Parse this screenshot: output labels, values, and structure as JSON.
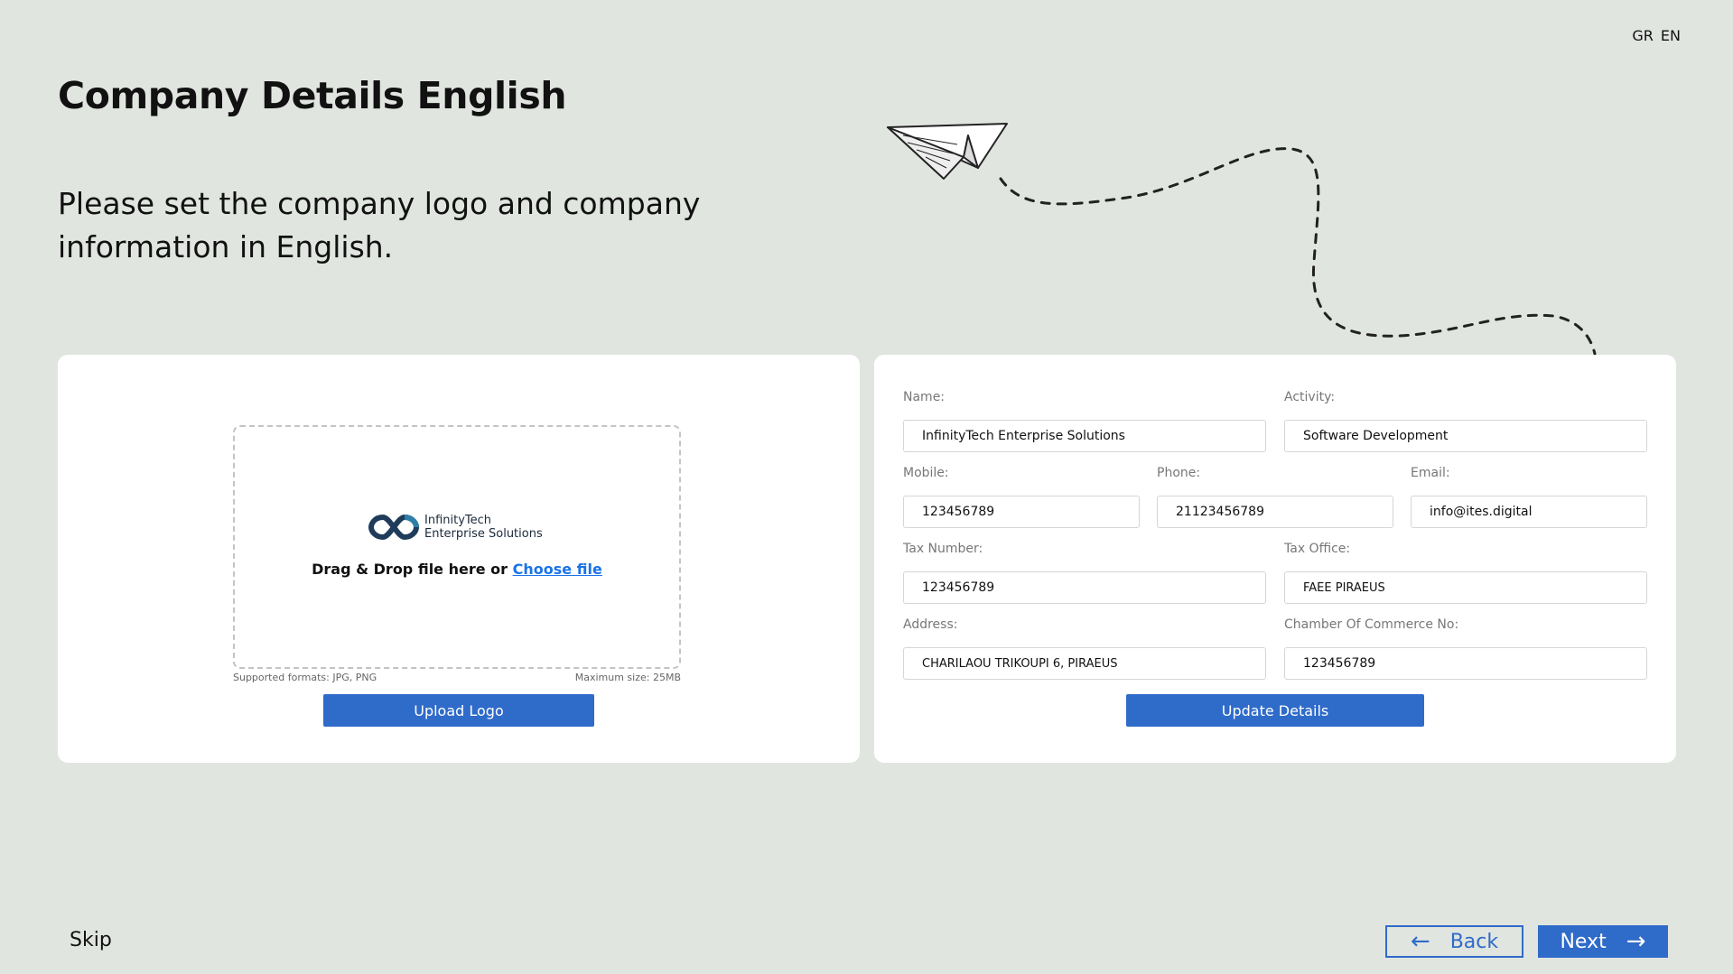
{
  "lang": {
    "gr": "GR",
    "en": "EN"
  },
  "header": {
    "title": "Company Details English",
    "subtitle": "Please set the company logo and company information in English."
  },
  "upload": {
    "logo_line1": "InfinityTech",
    "logo_line2": "Enterprise Solutions",
    "drop_text": "Drag & Drop file here or ",
    "choose_link": "Choose file",
    "formats": "Supported formats: JPG, PNG",
    "max_size": "Maximum size: 25MB",
    "button": "Upload Logo"
  },
  "form": {
    "name_label": "Name:",
    "name_value": "InfinityTech Enterprise Solutions",
    "activity_label": "Activity:",
    "activity_value": "Software Development",
    "mobile_label": "Mobile:",
    "mobile_value": "123456789",
    "phone_label": "Phone:",
    "phone_value": "21123456789",
    "email_label": "Email:",
    "email_value": "info@ites.digital",
    "tax_number_label": "Tax Number:",
    "tax_number_value": "123456789",
    "tax_office_label": "Tax Office:",
    "tax_office_value": "FAEE PIRAEUS",
    "address_label": "Address:",
    "address_value": "CHARILAOU TRIKOUPI 6, PIRAEUS",
    "chamber_label": "Chamber Of Commerce No:",
    "chamber_value": "123456789",
    "button": "Update Details"
  },
  "nav": {
    "skip": "Skip",
    "back": "Back",
    "next": "Next"
  },
  "colors": {
    "accent": "#2f6bc9",
    "link": "#1a73e8",
    "background": "#e1e5e0"
  }
}
